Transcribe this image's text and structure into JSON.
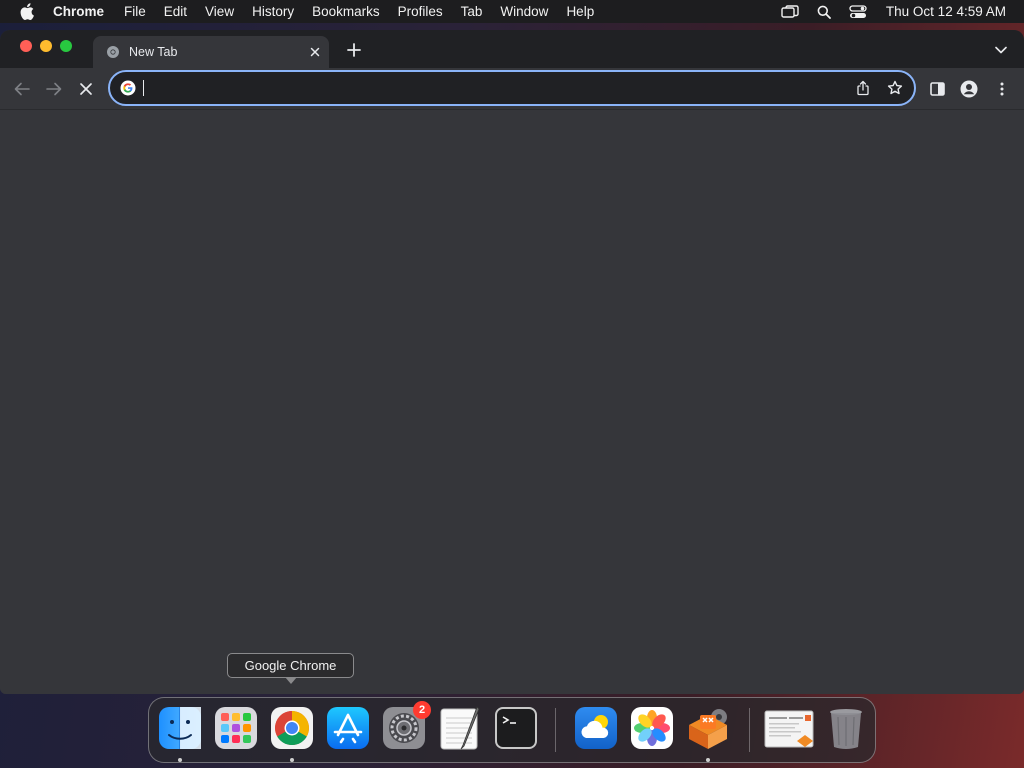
{
  "menubar": {
    "apple_icon": "apple-logo-icon",
    "app_name": "Chrome",
    "items": [
      "File",
      "Edit",
      "View",
      "History",
      "Bookmarks",
      "Profiles",
      "Tab",
      "Window",
      "Help"
    ],
    "status_icons": [
      "screen-mirroring-icon",
      "spotlight-search-icon",
      "control-center-icon"
    ],
    "clock": "Thu Oct 12  4:59 AM"
  },
  "browser": {
    "tab": {
      "title": "New Tab",
      "favicon": "chrome-favicon-icon"
    },
    "toolbar": {
      "back_icon": "back-arrow-icon",
      "forward_icon": "forward-arrow-icon",
      "stop_icon": "stop-loading-icon"
    },
    "omnibox": {
      "value": "",
      "placeholder": "",
      "left_icon": "google-g-icon"
    },
    "accent_color": "#8ab4f8"
  },
  "dock": {
    "tooltip": "Google Chrome",
    "apps": [
      {
        "name": "Finder",
        "running": true
      },
      {
        "name": "Launchpad",
        "running": false
      },
      {
        "name": "Google Chrome",
        "running": true
      },
      {
        "name": "App Store",
        "running": false
      },
      {
        "name": "System Settings",
        "running": false,
        "badge": "2"
      },
      {
        "name": "TextEdit",
        "running": false
      },
      {
        "name": "Terminal",
        "running": false
      },
      {
        "name": "Weather",
        "running": false
      },
      {
        "name": "Photos",
        "running": false
      },
      {
        "name": "XAMPP",
        "running": true
      },
      {
        "name": "Downloads Stack",
        "running": false
      },
      {
        "name": "Trash",
        "running": false
      }
    ]
  }
}
